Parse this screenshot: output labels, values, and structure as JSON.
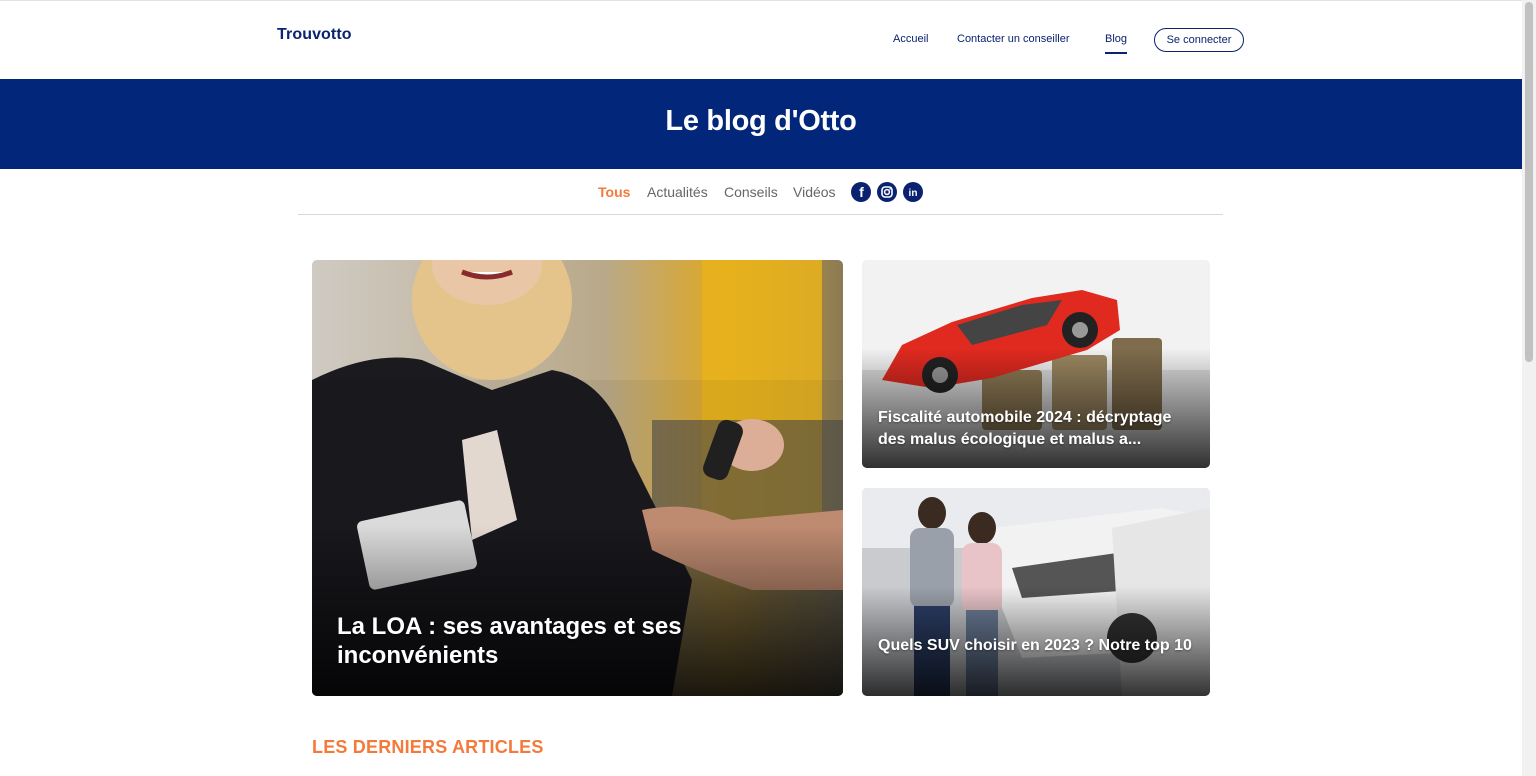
{
  "header": {
    "logo": "Trouvotto",
    "nav": [
      {
        "label": "Accueil"
      },
      {
        "label": "Contacter un conseiller"
      },
      {
        "label": "Blog",
        "active": true
      }
    ],
    "login_label": "Se connecter"
  },
  "banner": {
    "title": "Le blog d'Otto"
  },
  "filters": {
    "tabs": [
      {
        "label": "Tous",
        "active": true
      },
      {
        "label": "Actualités"
      },
      {
        "label": "Conseils"
      },
      {
        "label": "Vidéos"
      }
    ],
    "social": [
      {
        "icon": "facebook-icon",
        "glyph": "f"
      },
      {
        "icon": "instagram-icon",
        "glyph": ""
      },
      {
        "icon": "linkedin-icon",
        "glyph": "in"
      }
    ]
  },
  "articles": {
    "featured": {
      "title": "La LOA : ses avantages et ses inconvénients",
      "image": "woman-handing-car-keys-photo"
    },
    "side": [
      {
        "title": "Fiscalité automobile 2024 : décryptage des malus écologique et malus a...",
        "image": "red-car-on-coins-photo"
      },
      {
        "title": "Quels SUV choisir en 2023 ? Notre top 10",
        "image": "car-dealership-photo"
      }
    ]
  },
  "latest": {
    "heading": "LES DERNIERS ARTICLES"
  },
  "colors": {
    "brand": "#02267a",
    "accent": "#f37a3a",
    "text_dark": "#0b2270"
  }
}
